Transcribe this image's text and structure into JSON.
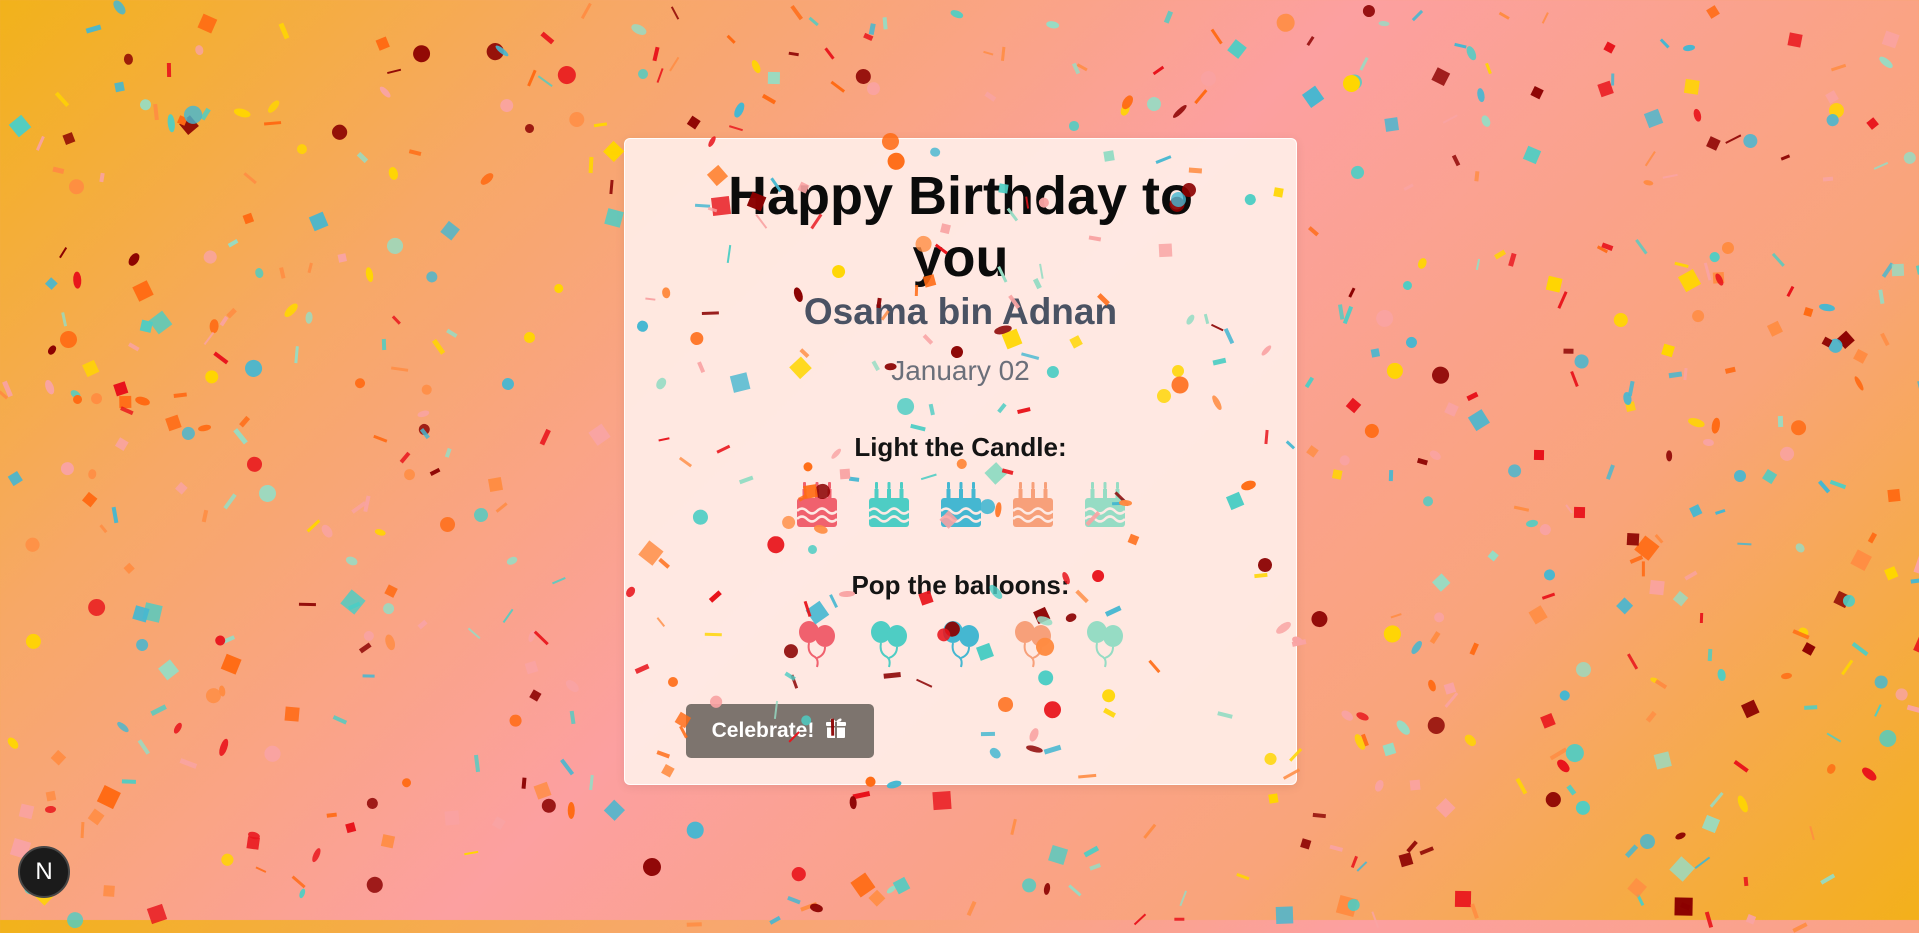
{
  "card": {
    "title_line1": "Happy Birthday to",
    "title_line2": "you",
    "name": "Osama bin Adnan",
    "date": "January 02",
    "candle_label": "Light the Candle:",
    "balloon_label": "Pop the balloons:",
    "celebrate_label": "Celebrate!",
    "celebrate_icon": "gift-icon"
  },
  "cakes": [
    {
      "icon": "birthday-cake-icon",
      "color": "#f0616e"
    },
    {
      "icon": "birthday-cake-icon",
      "color": "#4ecdc4"
    },
    {
      "icon": "birthday-cake-icon",
      "color": "#45b7d1"
    },
    {
      "icon": "birthday-cake-icon",
      "color": "#f7a07a"
    },
    {
      "icon": "birthday-cake-icon",
      "color": "#96dcc4"
    }
  ],
  "balloons": [
    {
      "icon": "balloons-icon",
      "color": "#f0616e"
    },
    {
      "icon": "balloons-icon",
      "color": "#4ecdc4"
    },
    {
      "icon": "balloons-icon",
      "color": "#45b7d1"
    },
    {
      "icon": "balloons-icon",
      "color": "#f7a07a"
    },
    {
      "icon": "balloons-icon",
      "color": "#96dcc4"
    }
  ],
  "badge": {
    "letter": "N"
  },
  "colors": {
    "confetti": [
      "#e8131b",
      "#8b0000",
      "#ff6a13",
      "#ffd600",
      "#4ecdc4",
      "#45b7d1",
      "#96dcc4",
      "#f9a3a3",
      "#ff8c42"
    ]
  }
}
